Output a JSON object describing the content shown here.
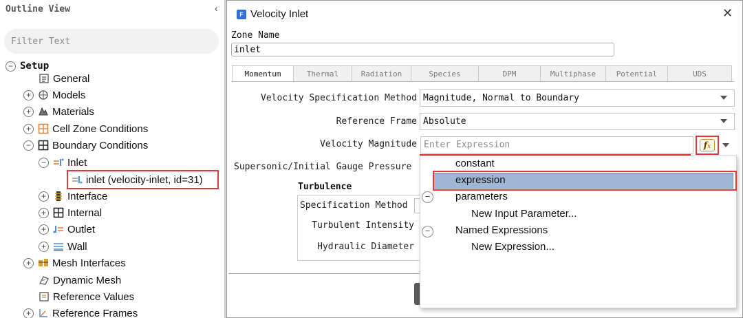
{
  "outline": {
    "title": "Outline View",
    "collapse_glyph": "‹",
    "filter_placeholder": "Filter Text",
    "tree": [
      {
        "label": "Setup",
        "icon": "minus-expander"
      },
      {
        "label": "General",
        "icon": "general-icon"
      },
      {
        "label": "Models",
        "icon": "models-icon"
      },
      {
        "label": "Materials",
        "icon": "materials-icon"
      },
      {
        "label": "Cell Zone Conditions",
        "icon": "cell-zone-icon"
      },
      {
        "label": "Boundary Conditions",
        "icon": "boundary-icon"
      },
      {
        "label": "Inlet",
        "icon": "inlet-icon"
      },
      {
        "label": "inlet (velocity-inlet, id=31)",
        "icon": "inlet-zone-icon"
      },
      {
        "label": "Interface",
        "icon": "interface-icon"
      },
      {
        "label": "Internal",
        "icon": "internal-icon"
      },
      {
        "label": "Outlet",
        "icon": "outlet-icon"
      },
      {
        "label": "Wall",
        "icon": "wall-icon"
      },
      {
        "label": "Mesh Interfaces",
        "icon": "mesh-interfaces-icon"
      },
      {
        "label": "Dynamic Mesh",
        "icon": "dynamic-mesh-icon"
      },
      {
        "label": "Reference Values",
        "icon": "reference-values-icon"
      },
      {
        "label": "Reference Frames",
        "icon": "reference-frames-icon"
      }
    ]
  },
  "dialog": {
    "title": "Velocity Inlet",
    "close_glyph": "✕",
    "zone_name_label": "Zone Name",
    "zone_name_value": "inlet",
    "tabs": [
      "Momentum",
      "Thermal",
      "Radiation",
      "Species",
      "DPM",
      "Multiphase",
      "Potential",
      "UDS"
    ],
    "fields": {
      "velocity_spec_label": "Velocity Specification Method",
      "velocity_spec_value": "Magnitude, Normal to Boundary",
      "reference_frame_label": "Reference Frame",
      "reference_frame_value": "Absolute",
      "velocity_magnitude_label": "Velocity Magnitude",
      "velocity_magnitude_placeholder": "Enter Expression",
      "fx_label": "f",
      "supersonic_label": "Supersonic/Initial Gauge Pressure"
    },
    "turbulence": {
      "title": "Turbulence",
      "spec_method_label": "Specification Method",
      "intensity_label": "Turbulent Intensity",
      "diameter_label": "Hydraulic Diameter"
    }
  },
  "popup_menu": {
    "items": [
      "constant",
      "expression",
      "parameters",
      "New Input Parameter...",
      "Named Expressions",
      "New Expression..."
    ],
    "selected": "expression"
  },
  "colors": {
    "highlight_red": "#e0383b",
    "selection_blue": "#9fb7d4",
    "app_icon_blue": "#2f6fd6"
  }
}
